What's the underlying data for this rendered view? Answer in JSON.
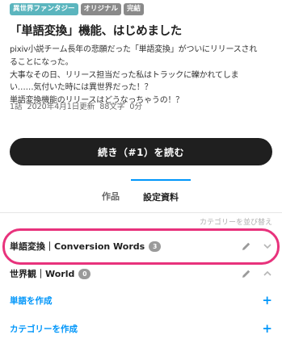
{
  "tags": [
    "異世界ファンタジー",
    "オリジナル",
    "完結"
  ],
  "title": "「単語変換」機能、はじめました",
  "description": [
    "pixiv小説チーム長年の悲願だった「単語変換」がついにリリースされ",
    "ることになった。",
    "大事なその日、リリース担当だった私はトラックに轢かれてしま",
    "い……気付いた時には異世界だった！？",
    "単語変換機能のリリースはどうなっちゃうの！？"
  ],
  "meta": {
    "episodes": "1話",
    "updated": "2020年4月1日更新",
    "chars": "88文字",
    "minutes": "0分"
  },
  "read_button": "続き（#1）を読む",
  "tabs": {
    "works": "作品",
    "settings": "設定資料"
  },
  "reorder_label": "カテゴリーを並び替え",
  "categories": [
    {
      "label": "単語変換｜Conversion Words",
      "count": "3",
      "expanded": false
    },
    {
      "label": "世界観｜World",
      "count": "0",
      "expanded": true
    }
  ],
  "actions": {
    "create_word": "単語を作成",
    "create_category": "カテゴリーを作成",
    "plus_symbol": "+"
  },
  "colors": {
    "accent_blue": "#0096fa",
    "highlight_pink": "#e8327c",
    "tag_teal": "#5bb5be",
    "tag_gray": "#8a8a8a",
    "button_dark": "#1f1f1f"
  },
  "icons": [
    "pencil-icon",
    "chevron-down-icon",
    "chevron-up-icon",
    "plus-icon"
  ]
}
